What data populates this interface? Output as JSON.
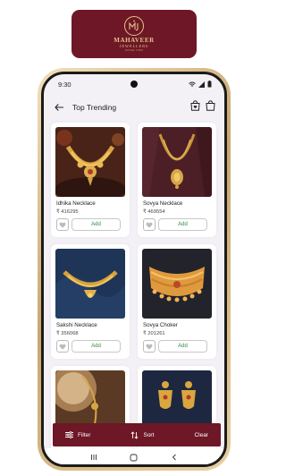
{
  "brand": {
    "monogram": "MJ",
    "name": "MAHAVEER",
    "subtitle": "JEWELLERS",
    "tagline": "SINCE 1985",
    "bg_color": "#6e1726",
    "gold_color": "#e2c48a"
  },
  "status_bar": {
    "time": "9:30"
  },
  "app_bar": {
    "title": "Top Trending",
    "back_icon": "arrow-left-icon",
    "wishlist_icon": "bag-heart-icon",
    "cart_icon": "shopping-bag-icon"
  },
  "products": [
    {
      "name": "Idhika Necklace",
      "price": "₹ 416295",
      "add_label": "Add"
    },
    {
      "name": "Sovya Necklace",
      "price": "₹ 469554",
      "add_label": "Add"
    },
    {
      "name": "Sakshi Necklace",
      "price": "₹ 356068",
      "add_label": "Add"
    },
    {
      "name": "Sovya Choker",
      "price": "₹ 201261",
      "add_label": "Add"
    },
    {
      "name": "",
      "price": "",
      "add_label": ""
    },
    {
      "name": "",
      "price": "",
      "add_label": ""
    }
  ],
  "bottom_bar": {
    "filter_label": "Filter",
    "sort_label": "Sort",
    "clear_label": "Clear"
  },
  "colors": {
    "accent": "#6e1726",
    "add_text": "#2e8b3c"
  }
}
